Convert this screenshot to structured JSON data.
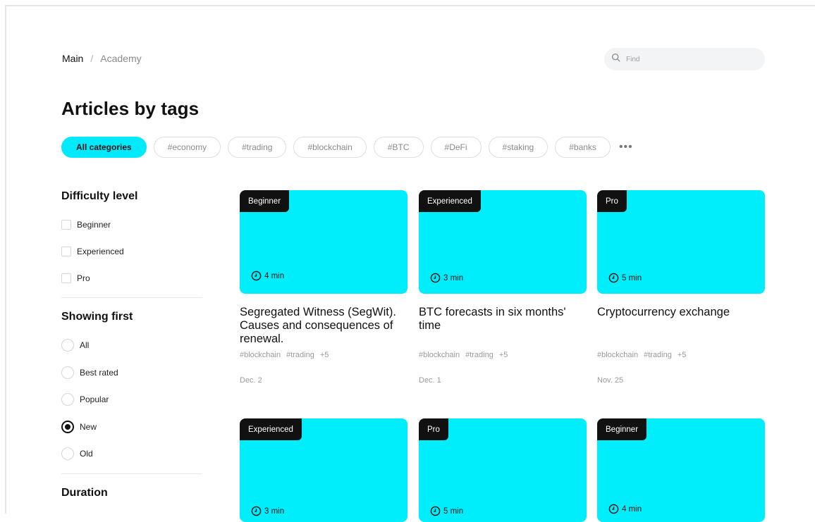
{
  "breadcrumb": {
    "main": "Main",
    "separator": "/",
    "current": "Academy"
  },
  "search": {
    "placeholder": "Find"
  },
  "page_title": "Articles by tags",
  "tags": [
    "All categories",
    "#economy",
    "#trading",
    "#blockchain",
    "#BTC",
    "#DeFi",
    "#staking",
    "#banks"
  ],
  "tags_more": "•••",
  "sidebar": {
    "difficulty": {
      "title": "Difficulty level",
      "options": [
        "Beginner",
        "Experienced",
        "Pro"
      ]
    },
    "showing_first": {
      "title": "Showing first",
      "options": [
        "All",
        "Best rated",
        "Popular",
        "New",
        "Old"
      ],
      "selected": "New"
    },
    "duration": {
      "title": "Duration"
    }
  },
  "colors": {
    "accent": "#00eefc",
    "badge": "#111111"
  },
  "cards": [
    {
      "level": "Beginner",
      "duration": "4 min",
      "title": "Segregated Witness (SegWit). Causes and consequences of renewal.",
      "tags": [
        "#blockchain",
        "#trading",
        "+5"
      ],
      "date": "Dec. 2"
    },
    {
      "level": "Experienced",
      "duration": "3 min",
      "title": "BTC forecasts in six months' time",
      "tags": [
        "#blockchain",
        "#trading",
        "+5"
      ],
      "date": "Dec. 1"
    },
    {
      "level": "Pro",
      "duration": "5 min",
      "title": "Cryptocurrency exchange",
      "tags": [
        "#blockchain",
        "#trading",
        "+5"
      ],
      "date": "Nov. 25"
    },
    {
      "level": "Experienced",
      "duration": "3 min",
      "title": "",
      "tags": [],
      "date": ""
    },
    {
      "level": "Pro",
      "duration": "5 min",
      "title": "",
      "tags": [],
      "date": ""
    },
    {
      "level": "Beginner",
      "duration": "4 min",
      "title": "",
      "tags": [],
      "date": ""
    }
  ]
}
